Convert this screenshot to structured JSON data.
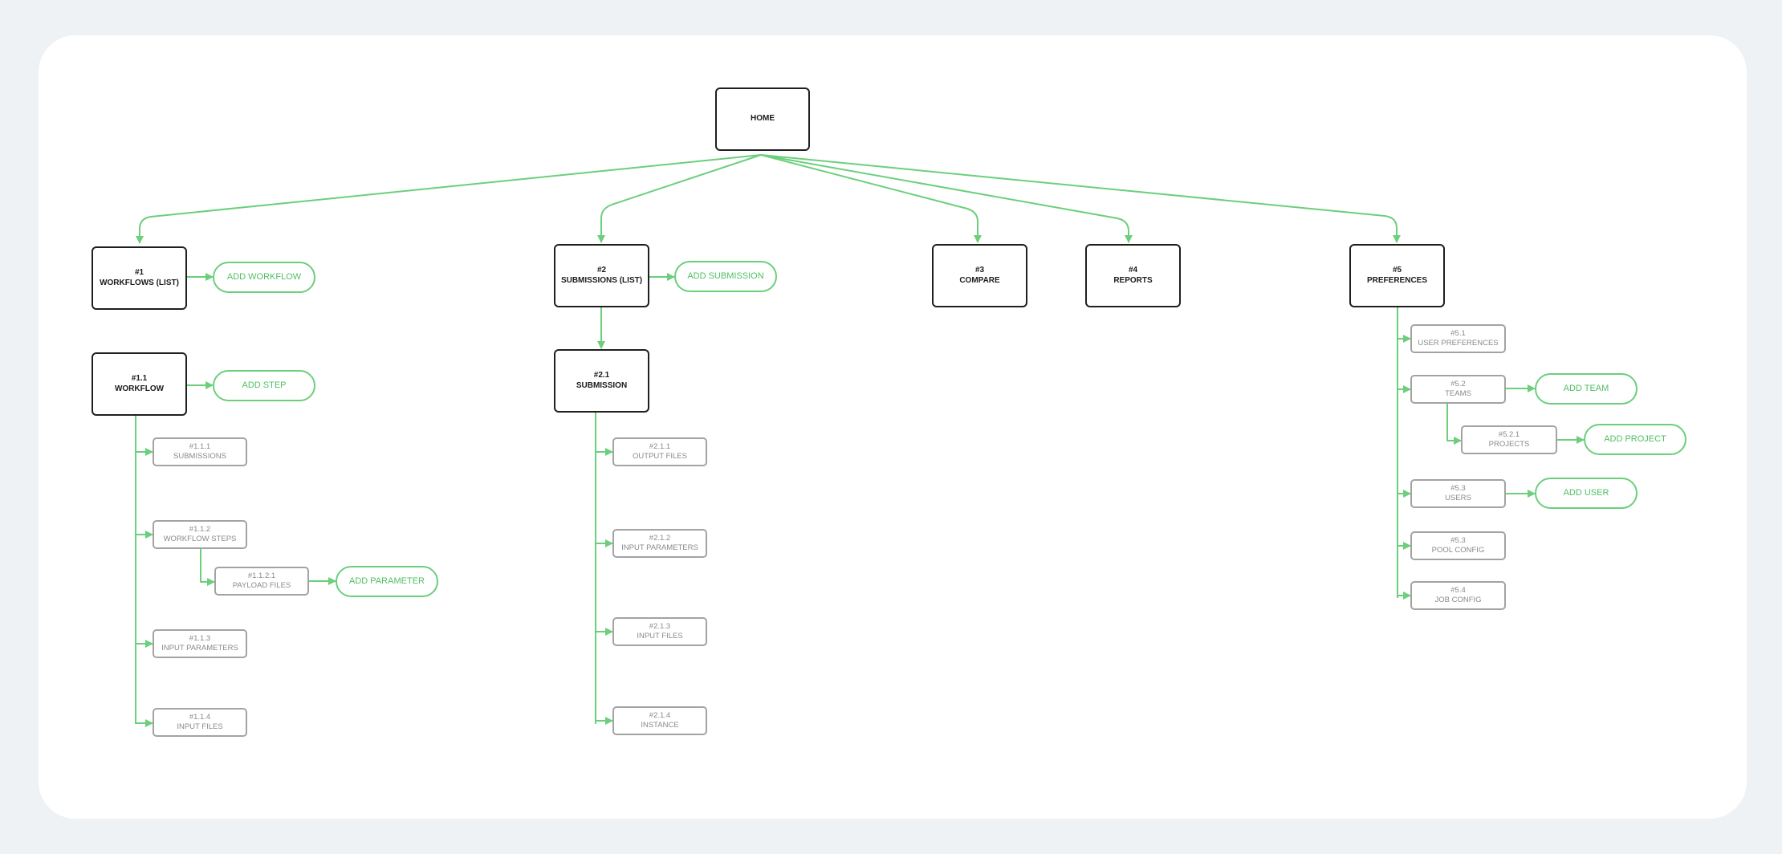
{
  "colors": {
    "background": "#eff2f5",
    "card": "#ffffff",
    "connector": "#6bcf7c",
    "main_border": "#1f1f1f",
    "sub_border": "#a3a3a3",
    "add_text": "#4fbf63"
  },
  "home": "HOME",
  "sections": {
    "workflows": {
      "num": "#1",
      "label": "WORKFLOWS (LIST)",
      "add": "ADD WORKFLOW"
    },
    "workflow": {
      "num": "#1.1",
      "label": "WORKFLOW",
      "add": "ADD STEP"
    },
    "wf_submissions": {
      "num": "#1.1.1",
      "label": "SUBMISSIONS"
    },
    "wf_steps": {
      "num": "#1.1.2",
      "label": "WORKFLOW STEPS"
    },
    "payload_files": {
      "num": "#1.1.2.1",
      "label": "PAYLOAD FILES",
      "add": "ADD PARAMETER"
    },
    "wf_input_params": {
      "num": "#1.1.3",
      "label": "INPUT PARAMETERS"
    },
    "wf_input_files": {
      "num": "#1.1.4",
      "label": "INPUT FILES"
    },
    "submissions": {
      "num": "#2",
      "label": "SUBMISSIONS (LIST)",
      "add": "ADD SUBMISSION"
    },
    "submission": {
      "num": "#2.1",
      "label": "SUBMISSION"
    },
    "output_files": {
      "num": "#2.1.1",
      "label": "OUTPUT FILES"
    },
    "sub_input_params": {
      "num": "#2.1.2",
      "label": "INPUT PARAMETERS"
    },
    "sub_input_files": {
      "num": "#2.1.3",
      "label": "INPUT FILES"
    },
    "instance": {
      "num": "#2.1.4",
      "label": "INSTANCE"
    },
    "compare": {
      "num": "#3",
      "label": "COMPARE"
    },
    "reports": {
      "num": "#4",
      "label": "REPORTS"
    },
    "preferences": {
      "num": "#5",
      "label": "PREFERENCES"
    },
    "user_prefs": {
      "num": "#5.1",
      "label": "USER PREFERENCES"
    },
    "teams": {
      "num": "#5.2",
      "label": "TEAMS",
      "add": "ADD TEAM"
    },
    "projects": {
      "num": "#5.2.1",
      "label": "PROJECTS",
      "add": "ADD PROJECT"
    },
    "users": {
      "num": "#5.3",
      "label": "USERS",
      "add": "ADD USER"
    },
    "pool_config": {
      "num": "#5.3",
      "label": "POOL CONFIG"
    },
    "job_config": {
      "num": "#5.4",
      "label": "JOB CONFIG"
    }
  }
}
